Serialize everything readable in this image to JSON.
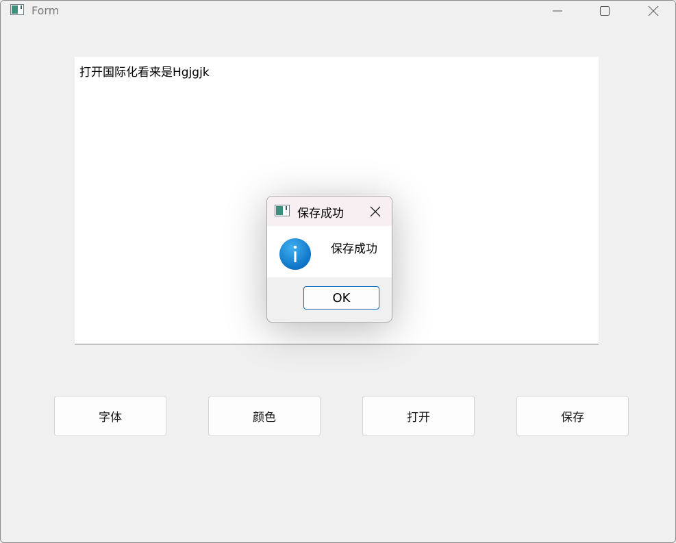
{
  "window": {
    "title": "Form",
    "icon": "app-window-icon"
  },
  "titlebar_buttons": {
    "minimize_icon": "minimize-icon",
    "maximize_icon": "maximize-icon",
    "close_icon": "close-icon"
  },
  "editor": {
    "text": "打开国际化看来是Hgjgjk"
  },
  "buttons": {
    "font": "字体",
    "color": "颜色",
    "open": "打开",
    "save": "保存"
  },
  "dialog": {
    "title": "保存成功",
    "message": "保存成功",
    "ok_label": "OK",
    "icon": "info-icon"
  },
  "colors": {
    "accent": "#0067c0",
    "info_icon": "#1a8ad6",
    "dialog_title_bg": "#f8eff2"
  }
}
